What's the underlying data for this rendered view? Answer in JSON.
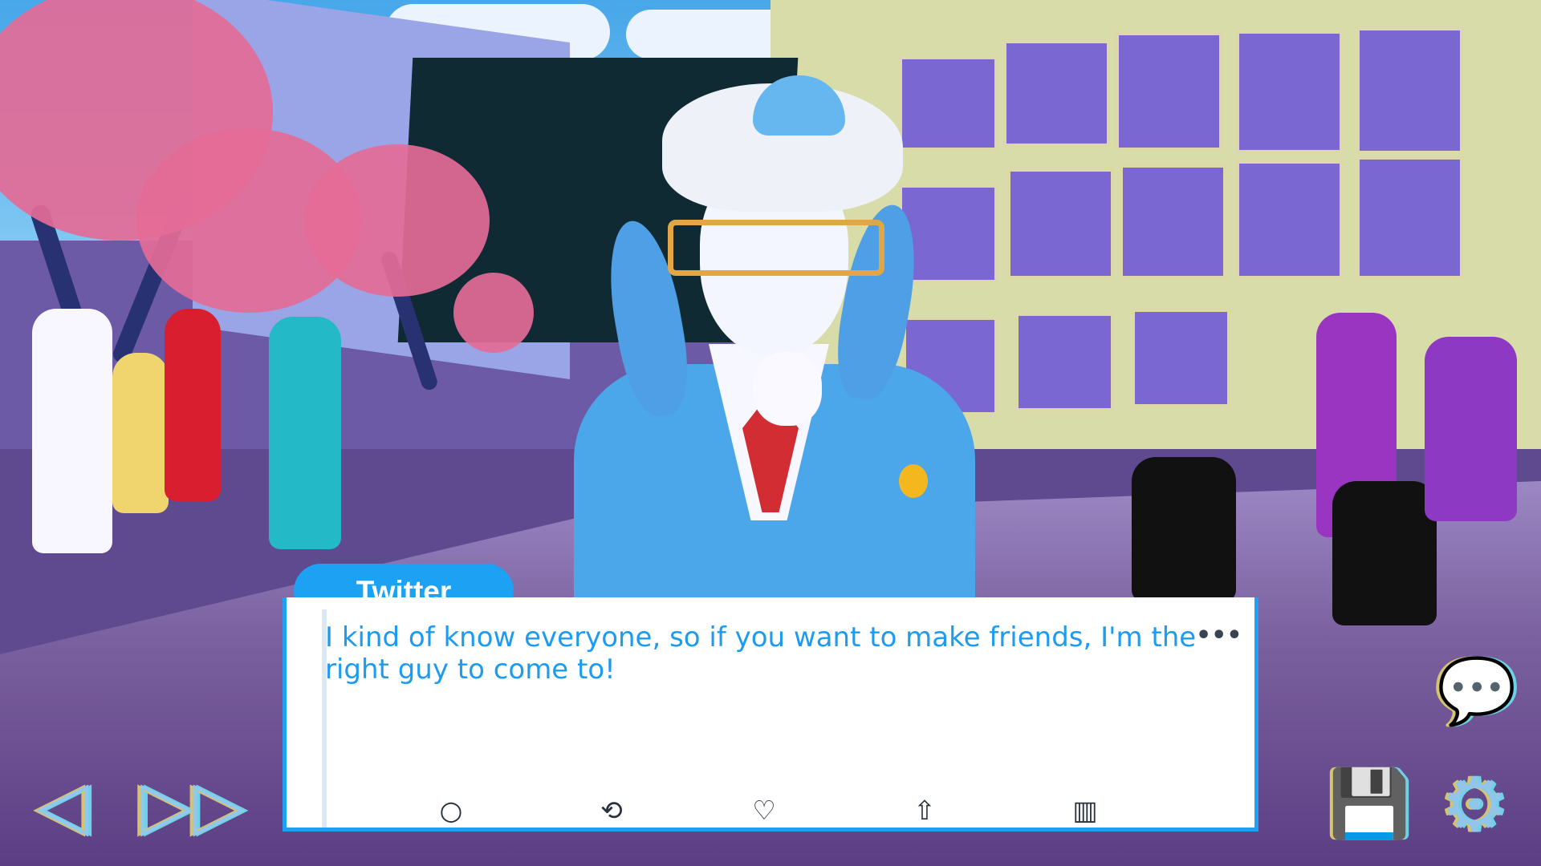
{
  "speaker": "Twitter",
  "dialog": {
    "line": "I kind of know everyone, so if you want to make friends, I'm the right guy to come to!",
    "more": "•••"
  },
  "controls": {
    "back": "◁",
    "skip": "▷▷",
    "chat_log": "💬",
    "save": "💾",
    "settings": "⚙"
  },
  "tweet_actions": {
    "reply": "○",
    "retweet": "⟲",
    "like": "♡",
    "share": "⇧",
    "stats": "▥"
  }
}
